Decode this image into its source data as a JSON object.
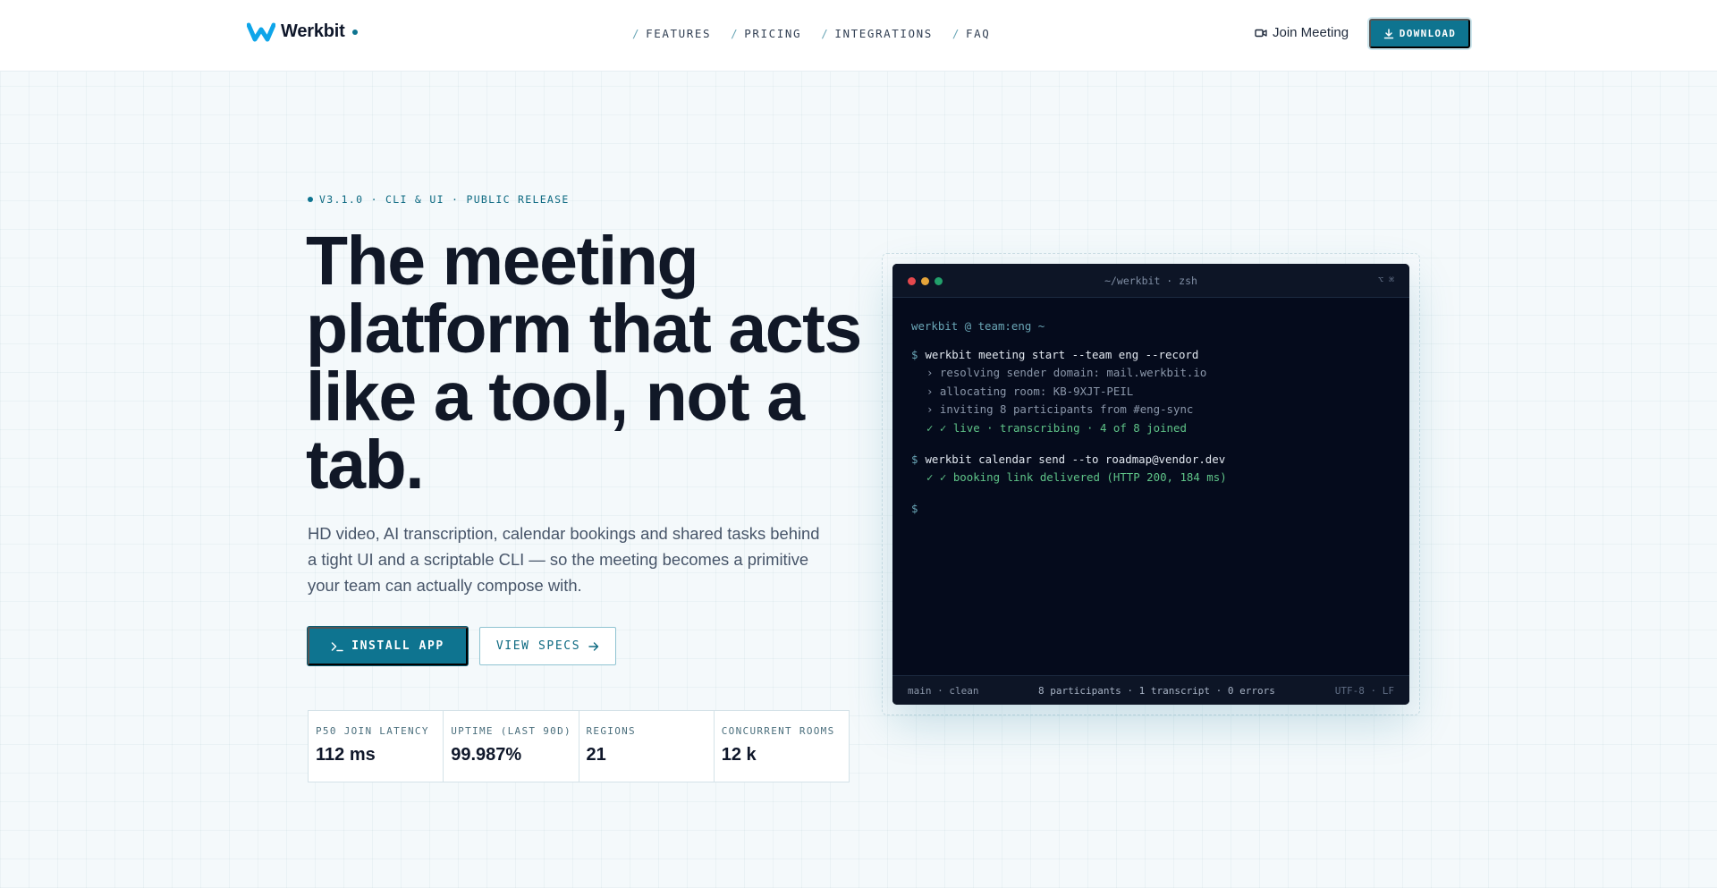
{
  "brand": {
    "name": "Werkbit",
    "icon": "werkbit-w-logo",
    "accent": "#0e7490",
    "logo_color": "#0ea5e9"
  },
  "nav": {
    "links": [
      {
        "slash": "/",
        "label": "FEATURES"
      },
      {
        "slash": "/",
        "label": "PRICING"
      },
      {
        "slash": "/",
        "label": "INTEGRATIONS"
      },
      {
        "slash": "/",
        "label": "FAQ"
      }
    ],
    "join_label": "Join Meeting",
    "join_icon": "video-camera-icon",
    "download_label": "DOWNLOAD",
    "download_icon": "download-icon"
  },
  "hero": {
    "badge": "V3.1.0 · CLI & UI · PUBLIC RELEASE",
    "headline": "The meeting platform that acts like a tool, not a tab.",
    "subtext": "HD video, AI transcription, calendar bookings and shared tasks behind a tight UI and a scriptable CLI — so the meeting becomes a primitive your team can actually compose with.",
    "install_label": "INSTALL APP",
    "install_icon": "terminal-prompt-icon",
    "specs_label": "VIEW SPECS",
    "specs_icon": "arrow-right-icon"
  },
  "stats": [
    {
      "label": "P50 JOIN LATENCY",
      "value": "112 ms"
    },
    {
      "label": "UPTIME (LAST 90D)",
      "value": "99.987%"
    },
    {
      "label": "REGIONS",
      "value": "21"
    },
    {
      "label": "CONCURRENT ROOMS",
      "value": "12 k"
    }
  ],
  "terminal": {
    "title": "~/werkbit · zsh",
    "shortcut": "⌥ ⌘",
    "prompt": "werkbit @ team:eng ~",
    "dollar": "$",
    "cmd1": "werkbit meeting start --team eng --record",
    "out1": [
      "› resolving sender domain: mail.werkbit.io",
      "› allocating room: KB-9XJT-PEIL",
      "› inviting 8 participants from #eng-sync"
    ],
    "ok1": "✓ ✓ live · transcribing · 4 of 8 joined",
    "cmd2": "werkbit calendar send --to roadmap@vendor.dev",
    "ok2": "✓ ✓ booking link delivered (HTTP 200, 184 ms)",
    "status_left": "main · clean",
    "status_mid": "8 participants · 1 transcript · 0 errors",
    "status_right": "UTF-8 · LF",
    "colors": {
      "bg": "#050b1c",
      "ok": "#5fc488",
      "prompt": "#6aa6b6"
    }
  }
}
